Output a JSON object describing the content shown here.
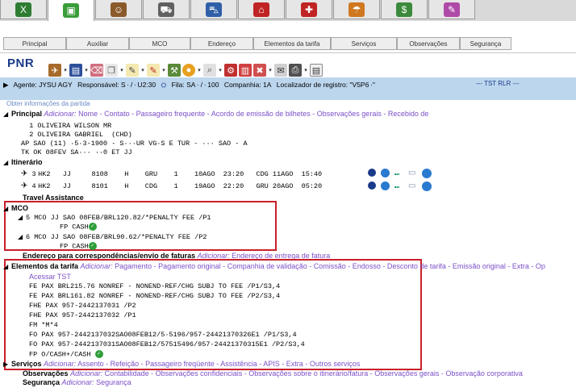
{
  "top_tabs": [
    {
      "name": "excel-module",
      "color": "#2e7d32",
      "glyph": "X"
    },
    {
      "name": "box-module",
      "color": "#3a9d3a",
      "glyph": "▣"
    },
    {
      "name": "people-module",
      "color": "#8a5a2a",
      "glyph": "☺"
    },
    {
      "name": "car-module",
      "color": "#606060",
      "glyph": "⛟"
    },
    {
      "name": "car2-module",
      "color": "#2f5fa8",
      "glyph": "⛍"
    },
    {
      "name": "hotel-module",
      "color": "#c02424",
      "glyph": "⌂"
    },
    {
      "name": "person-plus-module",
      "color": "#c02424",
      "glyph": "✚"
    },
    {
      "name": "umbrella-module",
      "color": "#d07820",
      "glyph": "☂"
    },
    {
      "name": "money-module",
      "color": "#3b8a3b",
      "glyph": "$"
    },
    {
      "name": "notes-module",
      "color": "#b04aa8",
      "glyph": "✎"
    }
  ],
  "sub_tabs": [
    "Principal",
    "Auxiliar",
    "MCO",
    "Endereço",
    "Elementos da tarifa",
    "Serviços",
    "Observações",
    "Segurança"
  ],
  "pnr_title": "PNR",
  "agent_bar": {
    "agente": "Agente: JYSU AGY",
    "responsavel": "Responsável: S · / · U2:30",
    "fila": "Fila: SA · / · 100",
    "companhia": "Companhia: 1A",
    "localizador": "Localizador de registro: \"V5P6 ·\"",
    "tst_link": "--- TST RLR ---",
    "obter": "Obter informações da partida"
  },
  "principal": {
    "title": "Principal",
    "adicionar": "Adicionar:",
    "links": [
      "Nome",
      "Contato",
      "Passageiro frequente",
      "Acordo de emissão de bilhetes",
      "Observações gerais",
      "Recebido de"
    ],
    "lines": [
      "  1 OLIVEIRA WILSON MR",
      "  2 OLIVEIRA GABRIEL  (CHD)",
      "AP SAO (11) ·5·3-1900 - S···UR VG·S E TUR - ··· SAO - A",
      "TK OK 08FEV SA··· ··0 ET JJ"
    ]
  },
  "itinerario": {
    "title": "Itinerário",
    "rows": [
      {
        "num": "3",
        "seg": "HK2   JJ     8108    H    GRU    1    10AGO  23:20   CDG 11AGO  15:40"
      },
      {
        "num": "4",
        "seg": "HK2   JJ     8101    H    CDG    1    19AGO  22:20   GRU 20AGO  05:20"
      }
    ],
    "travel_assistance": "Travel Assistance"
  },
  "mco": {
    "title": "MCO",
    "entries": [
      {
        "line": "5 MCO JJ SAO 08FEB/BRL120.82/*PENALTY FEE /P1",
        "fp": "FP CASH"
      },
      {
        "line": "6 MCO JJ SAO 08FEB/BRL90.62/*PENALTY FEE /P2",
        "fp": "FP CASH"
      }
    ]
  },
  "endereco": {
    "title": "Endereço para correspondências/envio de faturas",
    "adicionar": "Adicionar:",
    "link": "Endereço de entrega de fatura"
  },
  "elementos": {
    "title": "Elementos da tarifa",
    "adicionar": "Adicionar:",
    "links": [
      "Pagamento",
      "Pagamento original",
      "Companhia de validação",
      "Comissão",
      "Endosso",
      "Desconto de tarifa",
      "Emissão original",
      "Extra",
      "Op"
    ],
    "acessar_tst": "Acessar TST",
    "lines": [
      "FE PAX BRL215.76 NONREF - NONEND-REF/CHG SUBJ TO FEE /P1/S3,4",
      "FE PAX BRL161.82 NONREF - NONEND-REF/CHG SUBJ TO FEE /P2/S3,4",
      "FHE PAX 957-2442137031 /P2",
      "FHE PAX 957-2442137032 /P1",
      "FM *M*4",
      "FO PAX 957-2442137032SAO08FEB12/5·5196/957-24421370326E1 /P1/S3,4",
      "FO PAX 957-2442137031SAO08FEB12/57515496/957-24421370315E1 /P2/S3,4",
      "FP O/CASH+/CASH"
    ]
  },
  "servicos": {
    "title": "Serviços",
    "adicionar": "Adicionar:",
    "links": [
      "Assento",
      "Refeição",
      "Passageiro freqüente",
      "Assistência",
      "APIS",
      "Extra",
      "Outros serviços"
    ]
  },
  "observacoes": {
    "title": "Observações",
    "adicionar": "Adicionar:",
    "links": [
      "Contabilidade",
      "Observações confidenciais",
      "Observações sobre o itinerário/fatura",
      "Observações gerais",
      "Observação corporativa"
    ]
  },
  "seguranca": {
    "title": "Segurança",
    "adicionar": "Adicionar:",
    "link": "Segurança"
  },
  "colors": {
    "accent_red": "#c8202a",
    "link_purple": "#7b4fc8",
    "agent_bar": "#bcd6ee"
  }
}
